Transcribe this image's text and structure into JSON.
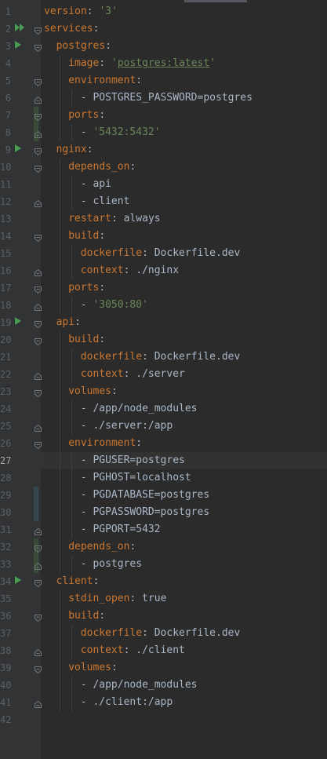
{
  "editor": {
    "language": "yaml",
    "current_line": 27,
    "lines": [
      {
        "n": "1",
        "indent": 0,
        "key": "version",
        "sep": ": ",
        "value": "'3'",
        "vtype": "str"
      },
      {
        "n": "2",
        "indent": 0,
        "key": "services",
        "sep": ":",
        "value": "",
        "vtype": "",
        "run": "double",
        "fold": "open"
      },
      {
        "n": "3",
        "indent": 2,
        "key": "postgres",
        "sep": ":",
        "value": "",
        "vtype": "",
        "run": "single",
        "fold": "open"
      },
      {
        "n": "4",
        "indent": 4,
        "key": "image",
        "sep": ": ",
        "value": "'postgres:latest'",
        "vtype": "str-underline"
      },
      {
        "n": "5",
        "indent": 4,
        "key": "environment",
        "sep": ":",
        "value": "",
        "vtype": "",
        "fold": "open"
      },
      {
        "n": "6",
        "indent": 6,
        "dash": true,
        "value": "POSTGRES_PASSWORD=postgres",
        "vtype": "plain",
        "fold": "close"
      },
      {
        "n": "7",
        "indent": 4,
        "key": "ports",
        "sep": ":",
        "value": "",
        "vtype": "",
        "fold": "open",
        "change": "add"
      },
      {
        "n": "8",
        "indent": 6,
        "dash": true,
        "value": "'5432:5432'",
        "vtype": "str",
        "fold": "close",
        "change": "add"
      },
      {
        "n": "9",
        "indent": 2,
        "key": "nginx",
        "sep": ":",
        "value": "",
        "vtype": "",
        "run": "single",
        "fold": "open"
      },
      {
        "n": "10",
        "indent": 4,
        "key": "depends_on",
        "sep": ":",
        "value": "",
        "vtype": "",
        "fold": "open"
      },
      {
        "n": "11",
        "indent": 6,
        "dash": true,
        "value": "api",
        "vtype": "plain"
      },
      {
        "n": "12",
        "indent": 6,
        "dash": true,
        "value": "client",
        "vtype": "plain",
        "fold": "close"
      },
      {
        "n": "13",
        "indent": 4,
        "key": "restart",
        "sep": ": ",
        "value": "always",
        "vtype": "plain"
      },
      {
        "n": "14",
        "indent": 4,
        "key": "build",
        "sep": ":",
        "value": "",
        "vtype": "",
        "fold": "open"
      },
      {
        "n": "15",
        "indent": 6,
        "key": "dockerfile",
        "sep": ": ",
        "value": "Dockerfile.dev",
        "vtype": "plain"
      },
      {
        "n": "16",
        "indent": 6,
        "key": "context",
        "sep": ": ",
        "value": "./nginx",
        "vtype": "plain",
        "fold": "close"
      },
      {
        "n": "17",
        "indent": 4,
        "key": "ports",
        "sep": ":",
        "value": "",
        "vtype": "",
        "fold": "open"
      },
      {
        "n": "18",
        "indent": 6,
        "dash": true,
        "value": "'3050:80'",
        "vtype": "str",
        "fold": "close"
      },
      {
        "n": "19",
        "indent": 2,
        "key": "api",
        "sep": ":",
        "value": "",
        "vtype": "",
        "run": "single",
        "fold": "open"
      },
      {
        "n": "20",
        "indent": 4,
        "key": "build",
        "sep": ":",
        "value": "",
        "vtype": "",
        "fold": "open"
      },
      {
        "n": "21",
        "indent": 6,
        "key": "dockerfile",
        "sep": ": ",
        "value": "Dockerfile.dev",
        "vtype": "plain"
      },
      {
        "n": "22",
        "indent": 6,
        "key": "context",
        "sep": ": ",
        "value": "./server",
        "vtype": "plain",
        "fold": "close"
      },
      {
        "n": "23",
        "indent": 4,
        "key": "volumes",
        "sep": ":",
        "value": "",
        "vtype": "",
        "fold": "open"
      },
      {
        "n": "24",
        "indent": 6,
        "dash": true,
        "value": "/app/node_modules",
        "vtype": "plain"
      },
      {
        "n": "25",
        "indent": 6,
        "dash": true,
        "value": "./server:/app",
        "vtype": "plain",
        "fold": "close"
      },
      {
        "n": "26",
        "indent": 4,
        "key": "environment",
        "sep": ":",
        "value": "",
        "vtype": "",
        "fold": "open"
      },
      {
        "n": "27",
        "indent": 6,
        "dash": true,
        "value": "PGUSER=postgres",
        "vtype": "plain"
      },
      {
        "n": "28",
        "indent": 6,
        "dash": true,
        "value": "PGHOST=localhost",
        "vtype": "plain"
      },
      {
        "n": "29",
        "indent": 6,
        "dash": true,
        "value": "PGDATABASE=postgres",
        "vtype": "plain",
        "change": "mod"
      },
      {
        "n": "30",
        "indent": 6,
        "dash": true,
        "value": "PGPASSWORD=postgres",
        "vtype": "plain",
        "change": "mod"
      },
      {
        "n": "31",
        "indent": 6,
        "dash": true,
        "value": "PGPORT=5432",
        "vtype": "plain",
        "fold": "close"
      },
      {
        "n": "32",
        "indent": 4,
        "key": "depends_on",
        "sep": ":",
        "value": "",
        "vtype": "",
        "fold": "open",
        "change": "add"
      },
      {
        "n": "33",
        "indent": 6,
        "dash": true,
        "value": "postgres",
        "vtype": "plain",
        "fold": "close",
        "change": "add"
      },
      {
        "n": "34",
        "indent": 2,
        "key": "client",
        "sep": ":",
        "value": "",
        "vtype": "",
        "run": "single",
        "fold": "open"
      },
      {
        "n": "35",
        "indent": 4,
        "key": "stdin_open",
        "sep": ": ",
        "value": "true",
        "vtype": "plain"
      },
      {
        "n": "36",
        "indent": 4,
        "key": "build",
        "sep": ":",
        "value": "",
        "vtype": "",
        "fold": "open"
      },
      {
        "n": "37",
        "indent": 6,
        "key": "dockerfile",
        "sep": ": ",
        "value": "Dockerfile.dev",
        "vtype": "plain"
      },
      {
        "n": "38",
        "indent": 6,
        "key": "context",
        "sep": ": ",
        "value": "./client",
        "vtype": "plain",
        "fold": "close"
      },
      {
        "n": "39",
        "indent": 4,
        "key": "volumes",
        "sep": ":",
        "value": "",
        "vtype": "",
        "fold": "open"
      },
      {
        "n": "40",
        "indent": 6,
        "dash": true,
        "value": "/app/node_modules",
        "vtype": "plain"
      },
      {
        "n": "41",
        "indent": 6,
        "dash": true,
        "value": "./client:/app",
        "vtype": "plain",
        "fold": "close"
      },
      {
        "n": "42",
        "indent": 0,
        "value": "",
        "vtype": ""
      }
    ]
  },
  "colors": {
    "background": "#2b2b2b",
    "gutter": "#313335",
    "key": "#cc7832",
    "string": "#6a8759",
    "text": "#a9b7c6",
    "line_number": "#5d6164",
    "run_icon": "#499c54"
  },
  "icons": {
    "run_single": "run-icon",
    "run_double": "run-all-icon",
    "fold_open": "fold-open-icon",
    "fold_close": "fold-close-icon"
  }
}
